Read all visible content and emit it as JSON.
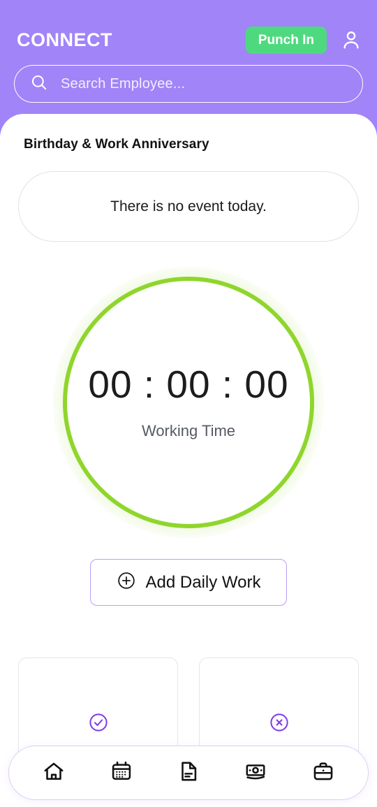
{
  "theme": {
    "header_purple": "#a184f7",
    "punch_green": "#4fd97f",
    "ring_green": "#8fd62c",
    "accent_purple": "#7c3aed",
    "border_purple": "#b79ff5",
    "sheet_white": "#ffffff"
  },
  "header": {
    "brand": "CONNECT",
    "punch_label": "Punch In",
    "avatar_icon": "user-icon"
  },
  "search": {
    "icon": "search-icon",
    "placeholder": "Search Employee...",
    "value": ""
  },
  "events": {
    "section_title": "Birthday & Work Anniversary",
    "empty_message": "There is no event today."
  },
  "timer": {
    "hours": "00",
    "minutes": "00",
    "seconds": "00",
    "display": "00 : 00 : 00",
    "label": "Working Time"
  },
  "actions": {
    "add_daily_work_label": "Add Daily Work",
    "add_icon": "plus-circle-icon"
  },
  "stat_cards": [
    {
      "name": "approved-card",
      "icon": "check-circle-icon"
    },
    {
      "name": "rejected-card",
      "icon": "x-circle-icon"
    }
  ],
  "bottom_nav": [
    {
      "name": "nav-home",
      "icon": "home-icon"
    },
    {
      "name": "nav-calendar",
      "icon": "calendar-icon"
    },
    {
      "name": "nav-documents",
      "icon": "document-icon"
    },
    {
      "name": "nav-payroll",
      "icon": "money-icon"
    },
    {
      "name": "nav-work",
      "icon": "briefcase-icon"
    }
  ]
}
